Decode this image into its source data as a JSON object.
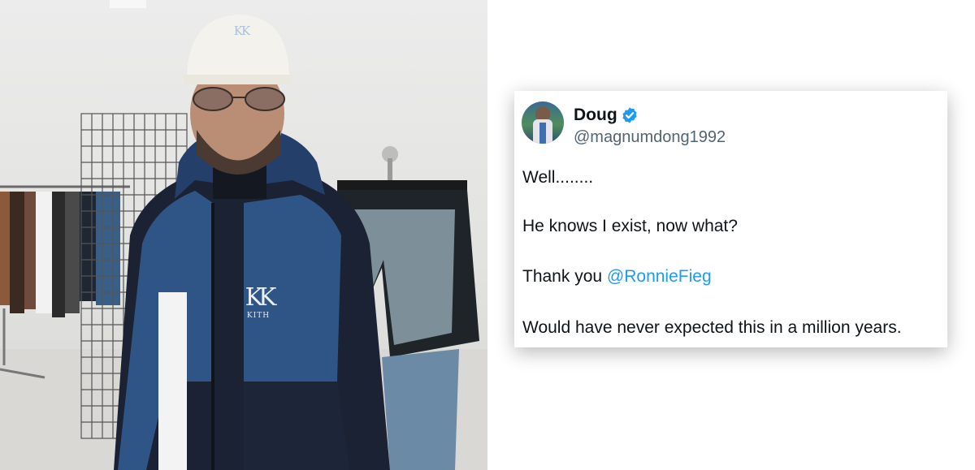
{
  "photo": {
    "cap_logo": "KK",
    "jacket_logo_monogram": "KK",
    "jacket_logo_word": "KITH"
  },
  "tweet": {
    "author_name": "Doug",
    "verified": true,
    "handle": "@magnumdong1992",
    "lines": [
      "Well........",
      "He knows I exist, now what?",
      "Thank you ",
      "Would have never expected this in a million years."
    ],
    "mention": "@RonnieFieg"
  },
  "colors": {
    "mention_link": "#1d9bf0",
    "verified_badge": "#1d9bf0",
    "jacket_blue": "#2f5486",
    "jacket_navy": "#1b2233"
  }
}
